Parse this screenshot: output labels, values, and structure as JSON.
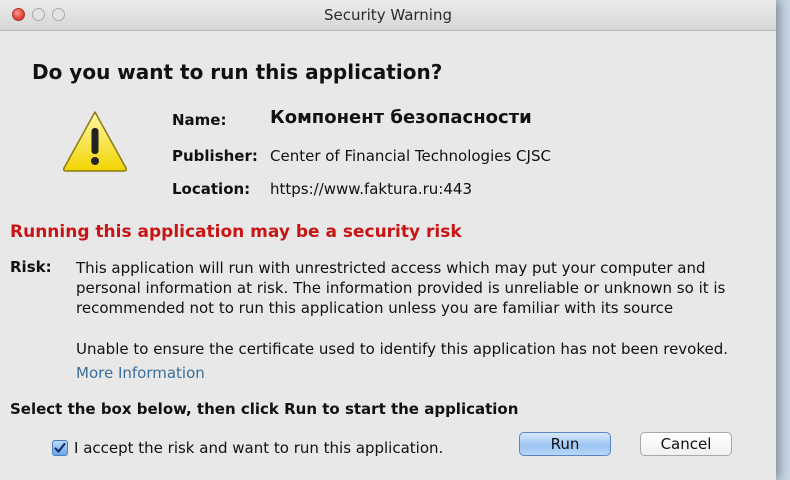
{
  "window": {
    "title": "Security Warning"
  },
  "dialog": {
    "question": "Do you want to run this application?",
    "name_label": "Name:",
    "name_value": "Компонент безопасности",
    "publisher_label": "Publisher:",
    "publisher_value": "Center of Financial Technologies CJSC",
    "location_label": "Location:",
    "location_value": "https://www.faktura.ru:443",
    "risk_heading": "Running this application may be a security risk",
    "risk_label": "Risk:",
    "risk_text": "This application will run with unrestricted access which may put your computer and personal information at risk. The information provided is unreliable or unknown so it is recommended not to run this application unless you are familiar with its source",
    "revoke_text": "Unable to ensure the certificate used to identify this application has not been revoked.",
    "more_info": "More Information",
    "instruction": "Select the box below, then click Run to start the application",
    "accept_label": "I accept the risk and want to run this application.",
    "accept_checked": true,
    "run_label": "Run",
    "cancel_label": "Cancel"
  },
  "colors": {
    "risk_heading": "#c81414",
    "link": "#3b6f9a",
    "accent": "#6aa6e8"
  },
  "icons": {
    "warning": "warning-triangle-icon",
    "check": "checkmark-icon"
  }
}
